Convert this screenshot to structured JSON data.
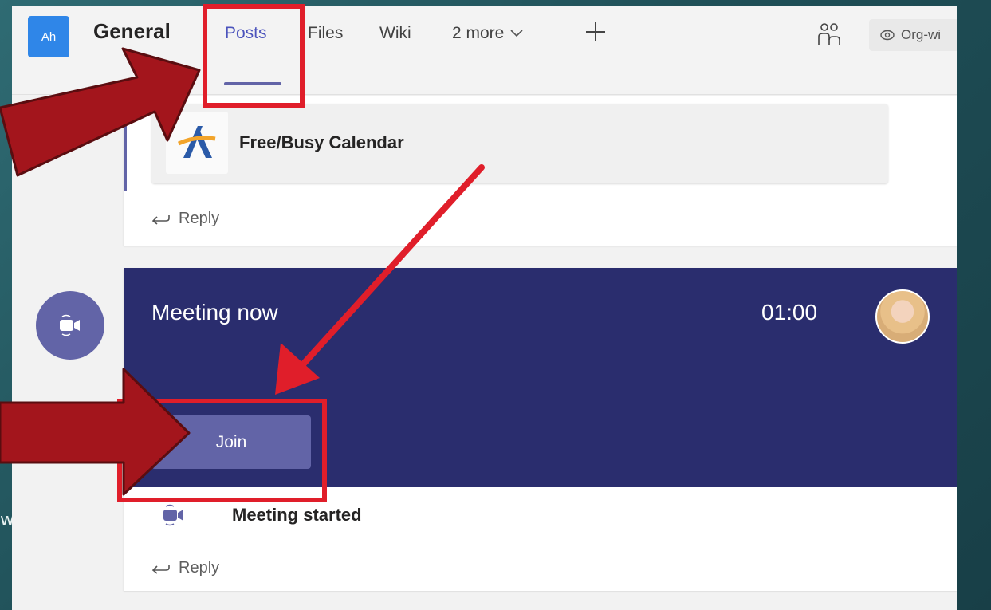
{
  "background": {
    "edge_text": "w"
  },
  "header": {
    "team_avatar": "Ah",
    "channel_name": "General",
    "tabs": [
      "Posts",
      "Files",
      "Wiki",
      "2 more"
    ],
    "org_wide": "Org-wi"
  },
  "posts": {
    "app_card_title": "Free/Busy Calendar",
    "reply_label": "Reply",
    "meeting": {
      "title": "Meeting now",
      "timer": "01:00",
      "join_label": "Join",
      "status": "Meeting started",
      "reply_label": "Reply"
    }
  },
  "colors": {
    "accent": "#6264a7",
    "meeting_banner": "#2a2d6e",
    "annotation_red": "#e01e2a",
    "arrow_fill": "#a3151c"
  },
  "icons": [
    "people-icon",
    "eye-icon",
    "chevron-down-icon",
    "plus-icon",
    "reply-icon",
    "video-camera-icon"
  ]
}
